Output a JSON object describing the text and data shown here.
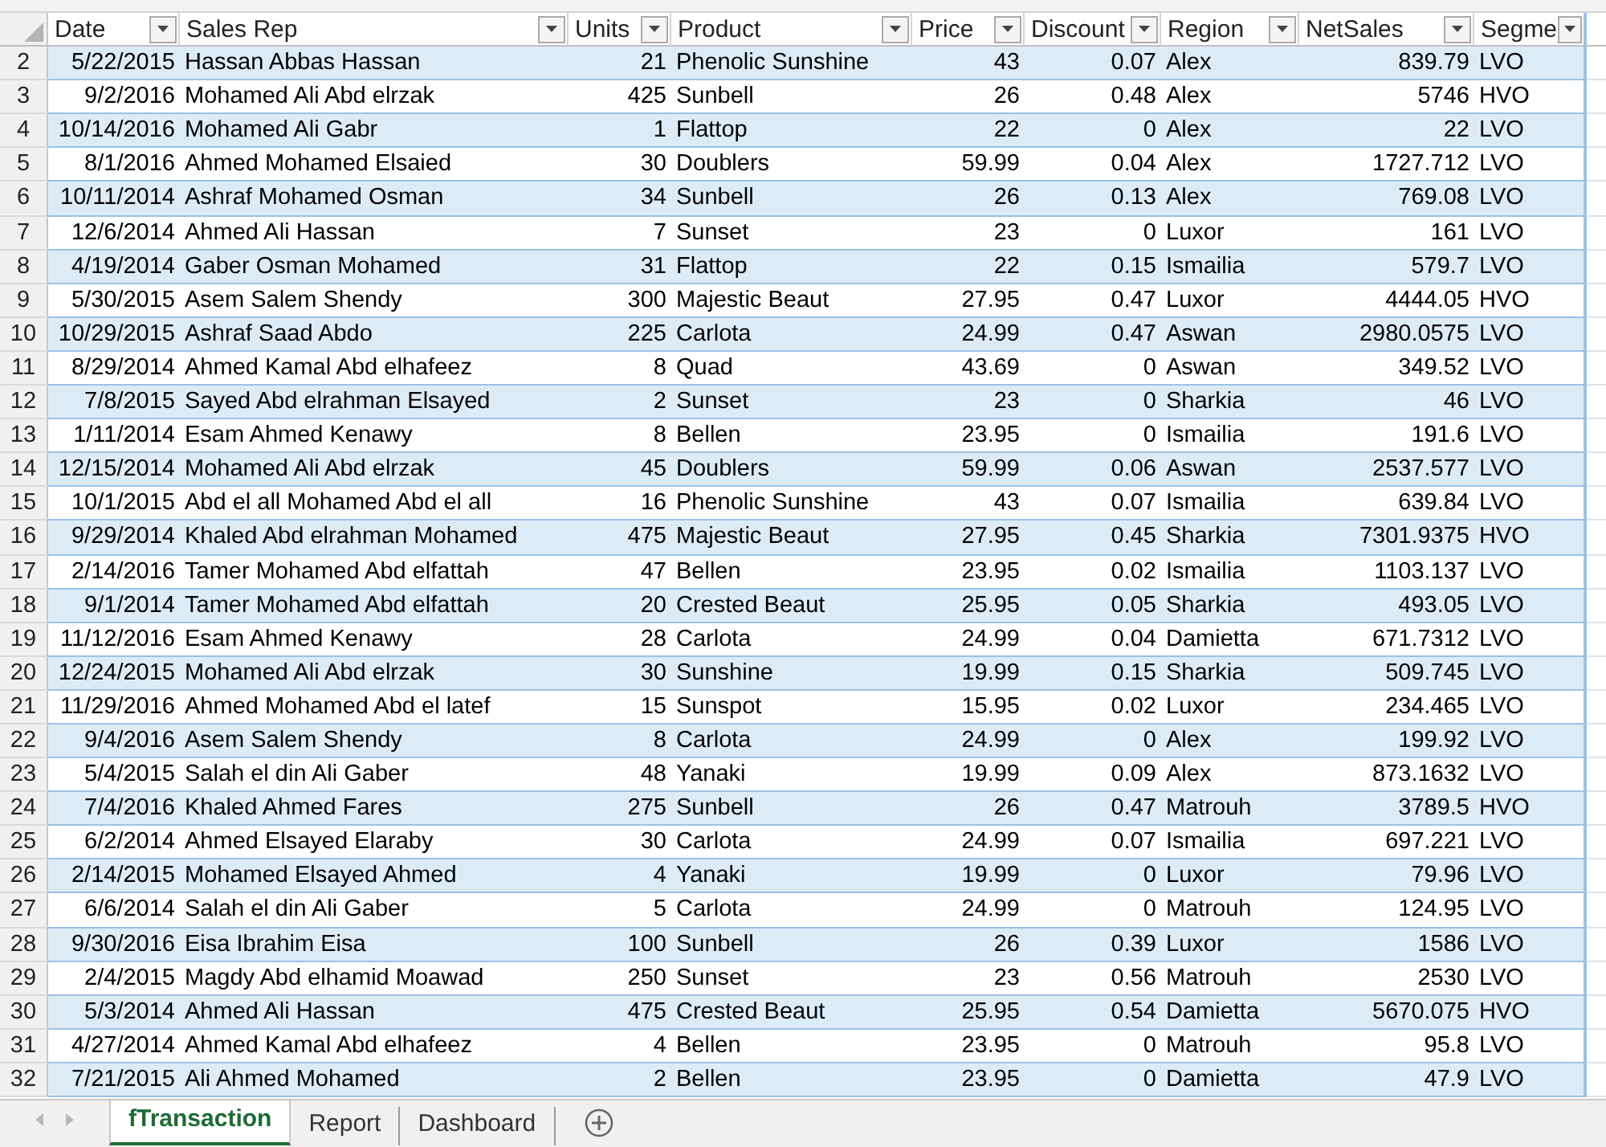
{
  "table": {
    "columns": [
      {
        "name": "Date",
        "kind": "number"
      },
      {
        "name": "Sales Rep",
        "kind": "text"
      },
      {
        "name": "Units",
        "kind": "number"
      },
      {
        "name": "Product",
        "kind": "text"
      },
      {
        "name": "Price",
        "kind": "number"
      },
      {
        "name": "Discount",
        "kind": "number"
      },
      {
        "name": "Region",
        "kind": "text"
      },
      {
        "name": "NetSales",
        "kind": "number"
      },
      {
        "name": "Segme",
        "kind": "text"
      }
    ],
    "rows": [
      {
        "row_number": "2",
        "cells": [
          "5/22/2015",
          "Hassan Abbas Hassan",
          "21",
          "Phenolic Sunshine",
          "43",
          "0.07",
          "Alex",
          "839.79",
          "LVO"
        ]
      },
      {
        "row_number": "3",
        "cells": [
          "9/2/2016",
          "Mohamed Ali Abd elrzak",
          "425",
          "Sunbell",
          "26",
          "0.48",
          "Alex",
          "5746",
          "HVO"
        ]
      },
      {
        "row_number": "4",
        "cells": [
          "10/14/2016",
          "Mohamed Ali Gabr",
          "1",
          "Flattop",
          "22",
          "0",
          "Alex",
          "22",
          "LVO"
        ]
      },
      {
        "row_number": "5",
        "cells": [
          "8/1/2016",
          "Ahmed Mohamed Elsaied",
          "30",
          "Doublers",
          "59.99",
          "0.04",
          "Alex",
          "1727.712",
          "LVO"
        ]
      },
      {
        "row_number": "6",
        "cells": [
          "10/11/2014",
          "Ashraf Mohamed Osman",
          "34",
          "Sunbell",
          "26",
          "0.13",
          "Alex",
          "769.08",
          "LVO"
        ]
      },
      {
        "row_number": "7",
        "cells": [
          "12/6/2014",
          "Ahmed Ali Hassan",
          "7",
          "Sunset",
          "23",
          "0",
          "Luxor",
          "161",
          "LVO"
        ]
      },
      {
        "row_number": "8",
        "cells": [
          "4/19/2014",
          "Gaber Osman Mohamed",
          "31",
          "Flattop",
          "22",
          "0.15",
          "Ismailia",
          "579.7",
          "LVO"
        ]
      },
      {
        "row_number": "9",
        "cells": [
          "5/30/2015",
          "Asem Salem Shendy",
          "300",
          "Majestic Beaut",
          "27.95",
          "0.47",
          "Luxor",
          "4444.05",
          "HVO"
        ]
      },
      {
        "row_number": "10",
        "cells": [
          "10/29/2015",
          "Ashraf Saad Abdo",
          "225",
          "Carlota",
          "24.99",
          "0.47",
          "Aswan",
          "2980.0575",
          "LVO"
        ]
      },
      {
        "row_number": "11",
        "cells": [
          "8/29/2014",
          "Ahmed Kamal Abd elhafeez",
          "8",
          "Quad",
          "43.69",
          "0",
          "Aswan",
          "349.52",
          "LVO"
        ]
      },
      {
        "row_number": "12",
        "cells": [
          "7/8/2015",
          "Sayed Abd elrahman Elsayed",
          "2",
          "Sunset",
          "23",
          "0",
          "Sharkia",
          "46",
          "LVO"
        ]
      },
      {
        "row_number": "13",
        "cells": [
          "1/11/2014",
          "Esam Ahmed Kenawy",
          "8",
          "Bellen",
          "23.95",
          "0",
          "Ismailia",
          "191.6",
          "LVO"
        ]
      },
      {
        "row_number": "14",
        "cells": [
          "12/15/2014",
          "Mohamed Ali Abd elrzak",
          "45",
          "Doublers",
          "59.99",
          "0.06",
          "Aswan",
          "2537.577",
          "LVO"
        ]
      },
      {
        "row_number": "15",
        "cells": [
          "10/1/2015",
          "Abd el all Mohamed Abd el all",
          "16",
          "Phenolic Sunshine",
          "43",
          "0.07",
          "Ismailia",
          "639.84",
          "LVO"
        ]
      },
      {
        "row_number": "16",
        "cells": [
          "9/29/2014",
          "Khaled Abd elrahman Mohamed",
          "475",
          "Majestic Beaut",
          "27.95",
          "0.45",
          "Sharkia",
          "7301.9375",
          "HVO"
        ]
      },
      {
        "row_number": "17",
        "cells": [
          "2/14/2016",
          "Tamer Mohamed Abd elfattah",
          "47",
          "Bellen",
          "23.95",
          "0.02",
          "Ismailia",
          "1103.137",
          "LVO"
        ]
      },
      {
        "row_number": "18",
        "cells": [
          "9/1/2014",
          "Tamer Mohamed Abd elfattah",
          "20",
          "Crested Beaut",
          "25.95",
          "0.05",
          "Sharkia",
          "493.05",
          "LVO"
        ]
      },
      {
        "row_number": "19",
        "cells": [
          "11/12/2016",
          "Esam Ahmed Kenawy",
          "28",
          "Carlota",
          "24.99",
          "0.04",
          "Damietta",
          "671.7312",
          "LVO"
        ]
      },
      {
        "row_number": "20",
        "cells": [
          "12/24/2015",
          "Mohamed Ali Abd elrzak",
          "30",
          "Sunshine",
          "19.99",
          "0.15",
          "Sharkia",
          "509.745",
          "LVO"
        ]
      },
      {
        "row_number": "21",
        "cells": [
          "11/29/2016",
          "Ahmed Mohamed Abd el latef",
          "15",
          "Sunspot",
          "15.95",
          "0.02",
          "Luxor",
          "234.465",
          "LVO"
        ]
      },
      {
        "row_number": "22",
        "cells": [
          "9/4/2016",
          "Asem Salem Shendy",
          "8",
          "Carlota",
          "24.99",
          "0",
          "Alex",
          "199.92",
          "LVO"
        ]
      },
      {
        "row_number": "23",
        "cells": [
          "5/4/2015",
          "Salah el din Ali Gaber",
          "48",
          "Yanaki",
          "19.99",
          "0.09",
          "Alex",
          "873.1632",
          "LVO"
        ]
      },
      {
        "row_number": "24",
        "cells": [
          "7/4/2016",
          "Khaled Ahmed Fares",
          "275",
          "Sunbell",
          "26",
          "0.47",
          "Matrouh",
          "3789.5",
          "HVO"
        ]
      },
      {
        "row_number": "25",
        "cells": [
          "6/2/2014",
          "Ahmed Elsayed Elaraby",
          "30",
          "Carlota",
          "24.99",
          "0.07",
          "Ismailia",
          "697.221",
          "LVO"
        ]
      },
      {
        "row_number": "26",
        "cells": [
          "2/14/2015",
          "Mohamed Elsayed Ahmed",
          "4",
          "Yanaki",
          "19.99",
          "0",
          "Luxor",
          "79.96",
          "LVO"
        ]
      },
      {
        "row_number": "27",
        "cells": [
          "6/6/2014",
          "Salah el din Ali Gaber",
          "5",
          "Carlota",
          "24.99",
          "0",
          "Matrouh",
          "124.95",
          "LVO"
        ]
      },
      {
        "row_number": "28",
        "cells": [
          "9/30/2016",
          "Eisa Ibrahim Eisa",
          "100",
          "Sunbell",
          "26",
          "0.39",
          "Luxor",
          "1586",
          "LVO"
        ]
      },
      {
        "row_number": "29",
        "cells": [
          "2/4/2015",
          "Magdy Abd elhamid Moawad",
          "250",
          "Sunset",
          "23",
          "0.56",
          "Matrouh",
          "2530",
          "LVO"
        ]
      },
      {
        "row_number": "30",
        "cells": [
          "5/3/2014",
          "Ahmed Ali Hassan",
          "475",
          "Crested Beaut",
          "25.95",
          "0.54",
          "Damietta",
          "5670.075",
          "HVO"
        ]
      },
      {
        "row_number": "31",
        "cells": [
          "4/27/2014",
          "Ahmed Kamal Abd elhafeez",
          "4",
          "Bellen",
          "23.95",
          "0",
          "Matrouh",
          "95.8",
          "LVO"
        ]
      },
      {
        "row_number": "32",
        "cells": [
          "7/21/2015",
          "Ali Ahmed Mohamed",
          "2",
          "Bellen",
          "23.95",
          "0",
          "Damietta",
          "47.9",
          "LVO"
        ]
      }
    ]
  },
  "sheet_tabs": [
    {
      "label": "fTransaction",
      "selected": true
    },
    {
      "label": "Report",
      "selected": false
    },
    {
      "label": "Dashboard",
      "selected": false
    }
  ]
}
